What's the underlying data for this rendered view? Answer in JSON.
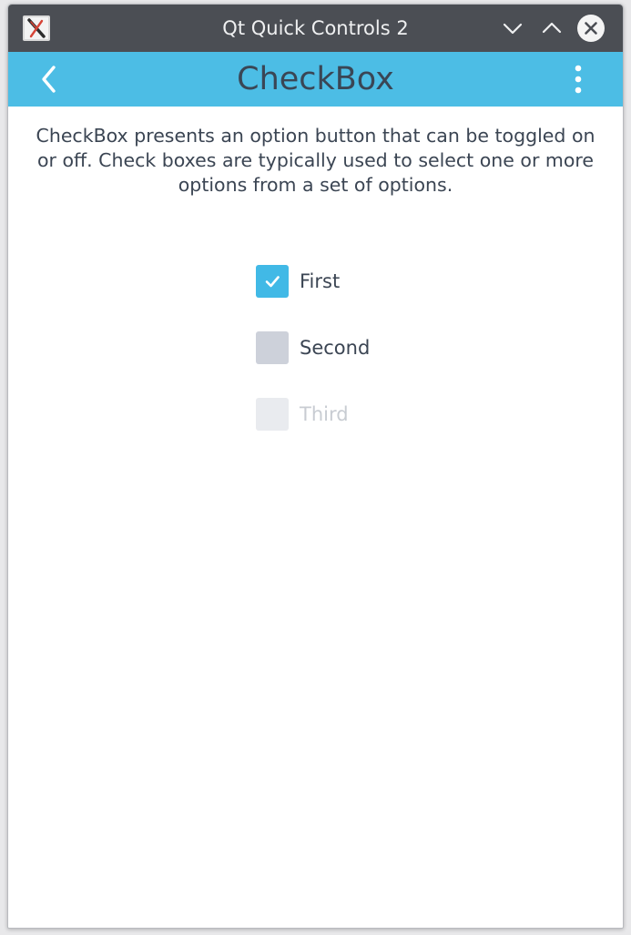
{
  "window": {
    "title": "Qt Quick Controls 2",
    "titlebar_color": "#4b4e54",
    "buttons": [
      "minimize-icon",
      "maximize-icon",
      "close-icon"
    ]
  },
  "header": {
    "title": "CheckBox",
    "color": "#4cbde5",
    "back_icon": "chevron-left-icon",
    "menu_icon": "vertical-dots-icon"
  },
  "description": "CheckBox presents an option button that can be toggled on or off. Check boxes are typically used to select one or more options from a set of options.",
  "checkboxes": [
    {
      "label": "First",
      "checked": true,
      "enabled": true
    },
    {
      "label": "Second",
      "checked": false,
      "enabled": true
    },
    {
      "label": "Third",
      "checked": false,
      "enabled": false
    }
  ]
}
